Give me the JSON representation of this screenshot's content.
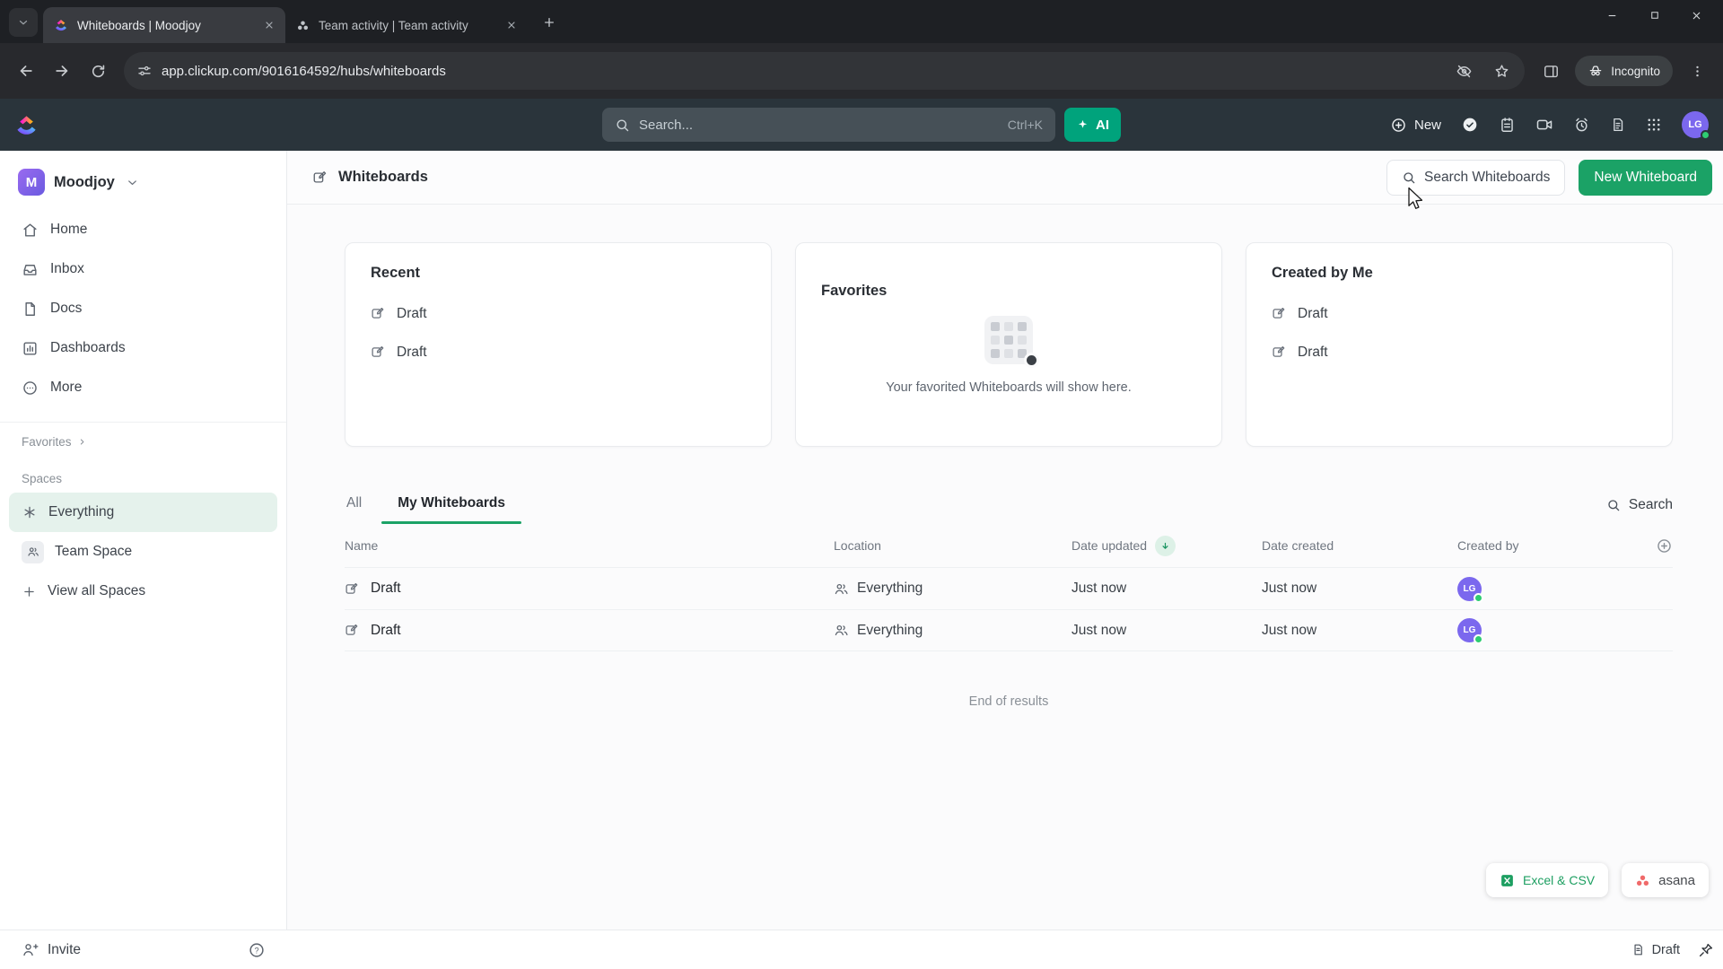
{
  "browser": {
    "tabs": [
      {
        "title": "Whiteboards | Moodjoy"
      },
      {
        "title": "Team activity | Team activity"
      }
    ],
    "url": "app.clickup.com/9016164592/hubs/whiteboards",
    "incognito_label": "Incognito"
  },
  "topbar": {
    "search_placeholder": "Search...",
    "search_shortcut": "Ctrl+K",
    "ai_label": "AI",
    "new_label": "New",
    "avatar_initials": "LG"
  },
  "sidebar": {
    "workspace_initial": "M",
    "workspace_name": "Moodjoy",
    "nav": [
      {
        "label": "Home"
      },
      {
        "label": "Inbox"
      },
      {
        "label": "Docs"
      },
      {
        "label": "Dashboards"
      },
      {
        "label": "More"
      }
    ],
    "favorites_label": "Favorites",
    "spaces_label": "Spaces",
    "spaces": [
      {
        "label": "Everything"
      },
      {
        "label": "Team Space"
      },
      {
        "label": "View all Spaces"
      }
    ]
  },
  "main": {
    "title": "Whiteboards",
    "search_whiteboards_label": "Search Whiteboards",
    "new_whiteboard_label": "New Whiteboard",
    "cards": [
      {
        "title": "Recent",
        "items": [
          "Draft",
          "Draft"
        ]
      },
      {
        "title": "Favorites",
        "empty_text": "Your favorited Whiteboards will show here."
      },
      {
        "title": "Created by Me",
        "items": [
          "Draft",
          "Draft"
        ]
      }
    ],
    "tabs": [
      {
        "label": "All"
      },
      {
        "label": "My Whiteboards"
      }
    ],
    "search_label": "Search",
    "table": {
      "columns": [
        "Name",
        "Location",
        "Date updated",
        "Date created",
        "Created by"
      ],
      "rows": [
        {
          "name": "Draft",
          "location": "Everything",
          "date_updated": "Just now",
          "date_created": "Just now",
          "created_by_initials": "LG"
        },
        {
          "name": "Draft",
          "location": "Everything",
          "date_updated": "Just now",
          "date_created": "Just now",
          "created_by_initials": "LG"
        }
      ]
    },
    "end_of_results": "End of results"
  },
  "footer": {
    "invite_label": "Invite",
    "excel_csv_label": "Excel & CSV",
    "asana_label": "asana",
    "draft_tray_label": "Draft"
  },
  "colors": {
    "accent_green": "#1ba266",
    "ai_green": "#00a37c",
    "brand_purple": "#7b68ee",
    "online_green": "#2ecc71"
  }
}
